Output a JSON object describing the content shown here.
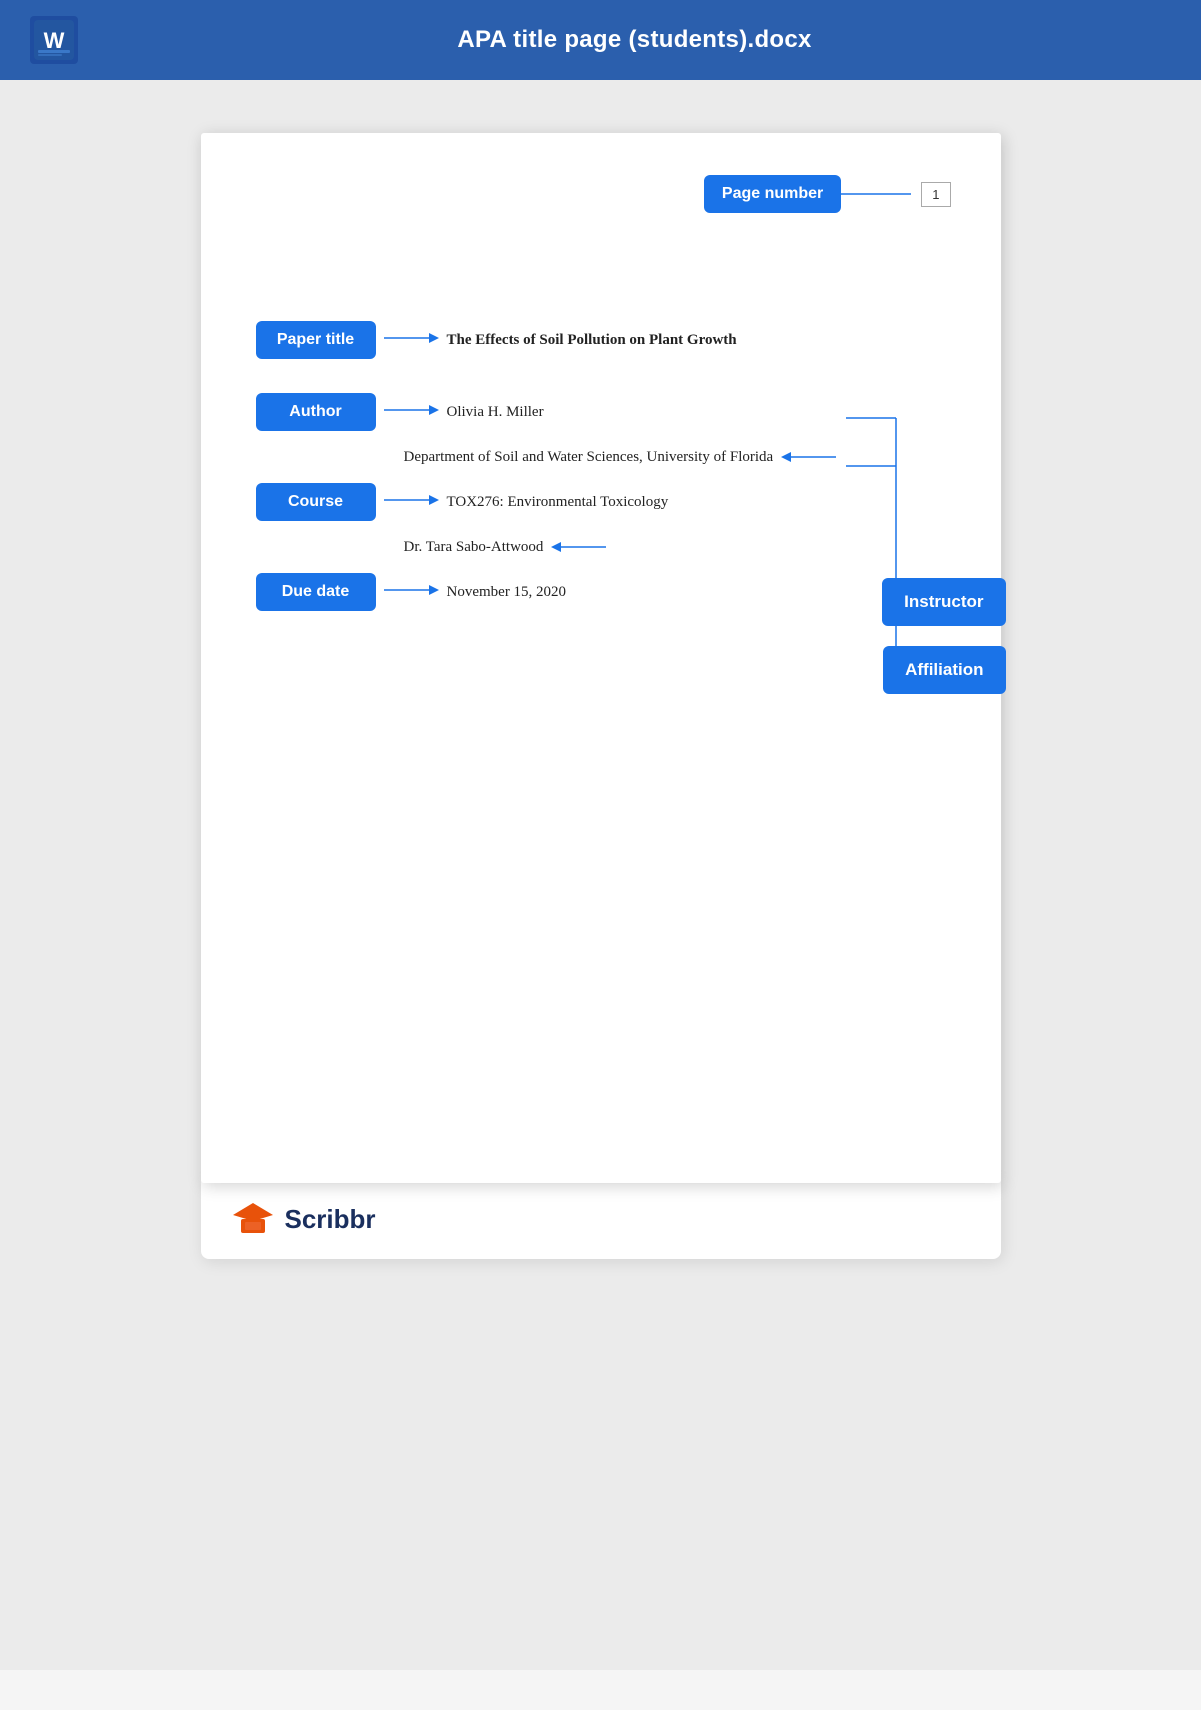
{
  "header": {
    "title": "APA title page (students).docx",
    "word_icon_label": "W"
  },
  "page_number_section": {
    "label": "Page number",
    "value": "1"
  },
  "annotations": {
    "paper_title": {
      "label": "Paper title",
      "value": "The Effects of Soil Pollution on Plant Growth"
    },
    "author": {
      "label": "Author",
      "value": "Olivia H. Miller"
    },
    "affiliation_text": "Department of Soil and Water Sciences, University of Florida",
    "course": {
      "label": "Course",
      "value": "TOX276: Environmental Toxicology"
    },
    "instructor_text": "Dr. Tara Sabo-Attwood",
    "due_date": {
      "label": "Due date",
      "value": "November 15, 2020"
    },
    "instructor_label": "Instructor",
    "affiliation_label": "Affiliation"
  },
  "footer": {
    "brand": "Scribbr"
  }
}
